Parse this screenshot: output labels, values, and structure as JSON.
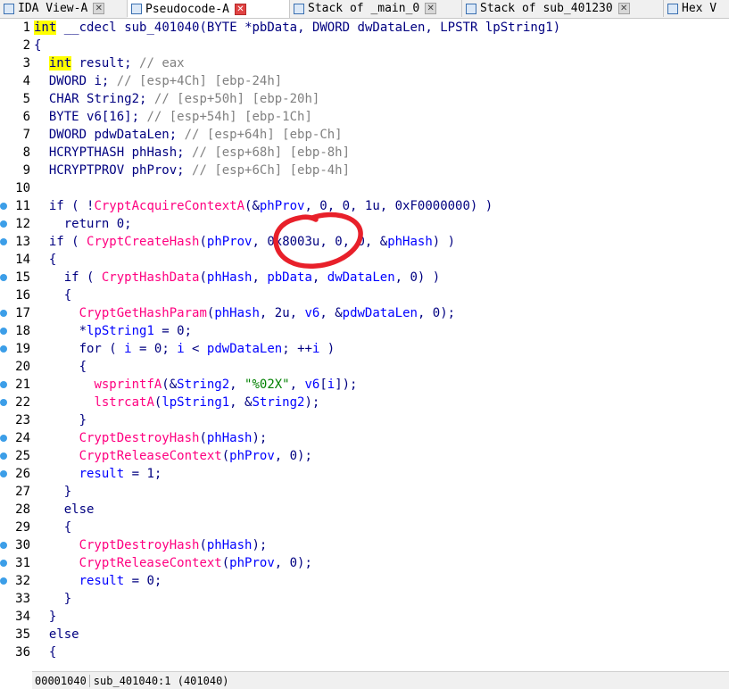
{
  "tabs": [
    {
      "label": "IDA View-A",
      "icon": "ida-view-icon",
      "close_style": "gray"
    },
    {
      "label": "Pseudocode-A",
      "icon": "pseudocode-icon",
      "close_style": "red",
      "active": true
    },
    {
      "label": "Stack of _main_0",
      "icon": "stack-icon",
      "close_style": "gray"
    },
    {
      "label": "Stack of sub_401230",
      "icon": "stack-icon",
      "close_style": "gray"
    },
    {
      "label": "Hex V",
      "icon": "hex-view-icon",
      "close_style": "none"
    }
  ],
  "code": {
    "lines": [
      {
        "n": "1",
        "dot": false,
        "text": "int __cdecl sub_401040(BYTE *pbData, DWORD dwDataLen, LPSTR lpString1)"
      },
      {
        "n": "2",
        "dot": false,
        "text": "{"
      },
      {
        "n": "3",
        "dot": false,
        "text": "  int result; // eax"
      },
      {
        "n": "4",
        "dot": false,
        "text": "  DWORD i; // [esp+4Ch] [ebp-24h]"
      },
      {
        "n": "5",
        "dot": false,
        "text": "  CHAR String2; // [esp+50h] [ebp-20h]"
      },
      {
        "n": "6",
        "dot": false,
        "text": "  BYTE v6[16]; // [esp+54h] [ebp-1Ch]"
      },
      {
        "n": "7",
        "dot": false,
        "text": "  DWORD pdwDataLen; // [esp+64h] [ebp-Ch]"
      },
      {
        "n": "8",
        "dot": false,
        "text": "  HCRYPTHASH phHash; // [esp+68h] [ebp-8h]"
      },
      {
        "n": "9",
        "dot": false,
        "text": "  HCRYPTPROV phProv; // [esp+6Ch] [ebp-4h]"
      },
      {
        "n": "10",
        "dot": false,
        "text": ""
      },
      {
        "n": "11",
        "dot": true,
        "text": "  if ( !CryptAcquireContextA(&phProv, 0, 0, 1u, 0xF0000000) )"
      },
      {
        "n": "12",
        "dot": true,
        "text": "    return 0;"
      },
      {
        "n": "13",
        "dot": true,
        "text": "  if ( CryptCreateHash(phProv, 0x8003u, 0, 0, &phHash) )"
      },
      {
        "n": "14",
        "dot": false,
        "text": "  {"
      },
      {
        "n": "15",
        "dot": true,
        "text": "    if ( CryptHashData(phHash, pbData, dwDataLen, 0) )"
      },
      {
        "n": "16",
        "dot": false,
        "text": "    {"
      },
      {
        "n": "17",
        "dot": true,
        "text": "      CryptGetHashParam(phHash, 2u, v6, &pdwDataLen, 0);"
      },
      {
        "n": "18",
        "dot": true,
        "text": "      *lpString1 = 0;"
      },
      {
        "n": "19",
        "dot": true,
        "text": "      for ( i = 0; i < pdwDataLen; ++i )"
      },
      {
        "n": "20",
        "dot": false,
        "text": "      {"
      },
      {
        "n": "21",
        "dot": true,
        "text": "        wsprintfA(&String2, \"%02X\", v6[i]);"
      },
      {
        "n": "22",
        "dot": true,
        "text": "        lstrcatA(lpString1, &String2);"
      },
      {
        "n": "23",
        "dot": false,
        "text": "      }"
      },
      {
        "n": "24",
        "dot": true,
        "text": "      CryptDestroyHash(phHash);"
      },
      {
        "n": "25",
        "dot": true,
        "text": "      CryptReleaseContext(phProv, 0);"
      },
      {
        "n": "26",
        "dot": true,
        "text": "      result = 1;"
      },
      {
        "n": "27",
        "dot": false,
        "text": "    }"
      },
      {
        "n": "28",
        "dot": false,
        "text": "    else"
      },
      {
        "n": "29",
        "dot": false,
        "text": "    {"
      },
      {
        "n": "30",
        "dot": true,
        "text": "      CryptDestroyHash(phHash);"
      },
      {
        "n": "31",
        "dot": true,
        "text": "      CryptReleaseContext(phProv, 0);"
      },
      {
        "n": "32",
        "dot": true,
        "text": "      result = 0;"
      },
      {
        "n": "33",
        "dot": false,
        "text": "    }"
      },
      {
        "n": "34",
        "dot": false,
        "text": "  }"
      },
      {
        "n": "35",
        "dot": false,
        "text": "  else"
      },
      {
        "n": "36",
        "dot": false,
        "text": "  {"
      }
    ]
  },
  "status": {
    "address": "00001040",
    "location": "sub_401040:1 (401040)"
  },
  "annotation": {
    "description": "hand-drawn red circle around 0x8003u",
    "color": "#e8202a"
  },
  "colors": {
    "keyword": "#000080",
    "function": "#ff0080",
    "variable": "#0000ff",
    "comment": "#808080",
    "string": "#008000",
    "highlight": "#ffff00",
    "breakpoint_dot": "#3c9ee8"
  }
}
